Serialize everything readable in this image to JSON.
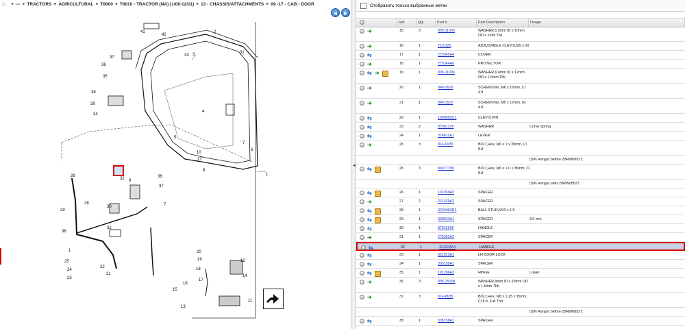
{
  "breadcrumb": [
    "---",
    "TRACTORS",
    "AGRICULTURAL",
    "T8000",
    "T8010 - TRACTOR (NA) (1/06-12/11)",
    "13 - CHASSIS/ATTACHMENTS",
    "09 -17 - CAB - DOOR"
  ],
  "nav": {
    "back": "◄",
    "forward": "►"
  },
  "filter_label": "Отобразить только выбранные метки",
  "columns": {
    "ref": "Ref",
    "qty": "Qty",
    "part": "Part #",
    "desc": "Part Description",
    "usage": "Usage"
  },
  "rows": [
    {
      "ref": "15",
      "qty": "3",
      "part": "895-11005",
      "desc": "WASHER,5.5mm ID x 10mm OD x 1mm Thk",
      "usage": "",
      "icons": [
        "gray",
        "arrow"
      ]
    },
    {
      "ref": "16",
      "qty": "1",
      "part": "713-125",
      "desc": "ADJUSTABLE CLEVIS,M5 x 20",
      "usage": "",
      "icons": [
        "gray",
        "arrow"
      ]
    },
    {
      "ref": "17",
      "qty": "1",
      "part": "275345A4",
      "desc": "COVER",
      "usage": "",
      "icons": [
        "gray",
        "swap"
      ]
    },
    {
      "ref": "18",
      "qty": "1",
      "part": "275344A6",
      "desc": "PROTECTOR",
      "usage": "",
      "icons": [
        "gray",
        "arrow"
      ]
    },
    {
      "ref": "19",
      "qty": "1",
      "part": "895-11006",
      "desc": "WASHER,6.6mm ID x 12mm OD x 1.6mm Thk",
      "usage": "",
      "icons": [
        "gray",
        "swap",
        "arrow2",
        "box2"
      ]
    },
    {
      "ref": "20",
      "qty": "1",
      "part": "840-1616",
      "desc": "SCREW,Pan, M6 x 16mm, Cl 4.8",
      "usage": "",
      "icons": [
        "gray",
        "arrow"
      ]
    },
    {
      "ref": "21",
      "qty": "1",
      "part": "840-1512",
      "desc": "SCREW,Pan, M5 x 12mm, Gr 4.8",
      "usage": "",
      "icons": [
        "gray",
        "arrow"
      ]
    },
    {
      "ref": "22",
      "qty": "1",
      "part": "1999650C1",
      "desc": "CLEVIS PIN",
      "usage": "",
      "icons": [
        "gray",
        "swap"
      ]
    },
    {
      "ref": "23",
      "qty": "2",
      "part": "87681226",
      "desc": "WASHER",
      "usage": "Curve Spring",
      "icons": [
        "gray",
        "swap"
      ]
    },
    {
      "ref": "24",
      "qty": "1",
      "part": "314611A1",
      "desc": "LEVER",
      "usage": "",
      "icons": [
        "gray",
        "swap"
      ]
    },
    {
      "ref": "25",
      "qty": "3",
      "part": "814-6035",
      "desc": "BOLT,Hex, M6 x 1 x 35mm, Cl 8.8",
      "usage": "",
      "icons": [
        "gray",
        "arrow"
      ]
    },
    {
      "note": "(S/N Range) before Z8RW08527;"
    },
    {
      "ref": "25",
      "qty": "3",
      "part": "86977789",
      "desc": "BOLT,Hex, M6 x 1.0 x 35mm, Cl 8.8",
      "usage": "",
      "icons": [
        "gray",
        "swap",
        "box"
      ]
    },
    {
      "note": "(S/N Range) after Z8RW08527;"
    },
    {
      "ref": "26",
      "qty": "1",
      "part": "191939A3",
      "desc": "SPACER",
      "usage": "",
      "icons": [
        "gray",
        "swap",
        "box"
      ]
    },
    {
      "ref": "27",
      "qty": "2",
      "part": "221429A2",
      "desc": "SPACER",
      "usage": "",
      "icons": [
        "gray",
        "arrow"
      ]
    },
    {
      "ref": "28",
      "qty": "1",
      "part": "3234063R1",
      "desc": "BALL STUD,M10 x 1.5",
      "usage": "",
      "icons": [
        "gray",
        "swap",
        "box"
      ]
    },
    {
      "ref": "29",
      "qty": "1",
      "part": "308633A1",
      "desc": "SPACER",
      "usage": "3.0 mm",
      "icons": [
        "gray",
        "swap",
        "box"
      ]
    },
    {
      "ref": "30",
      "qty": "1",
      "part": "87542696",
      "desc": "HANDLE",
      "usage": "",
      "icons": [
        "gray",
        "swap"
      ]
    },
    {
      "ref": "31",
      "qty": "1",
      "part": "275352A2",
      "desc": "SPACER",
      "usage": "",
      "icons": [
        "gray",
        "arrow"
      ]
    },
    {
      "ref": "32",
      "qty": "1",
      "part": "321023A4",
      "desc": "HANDLE",
      "usage": "",
      "icons": [
        "gray",
        "swap"
      ],
      "selected": true
    },
    {
      "ref": "33",
      "qty": "1",
      "part": "321013A1",
      "desc": "LH DOOR LOCK",
      "usage": "",
      "icons": [
        "gray",
        "swap"
      ]
    },
    {
      "ref": "34",
      "qty": "1",
      "part": "305159A1",
      "desc": "SPACER",
      "usage": "",
      "icons": [
        "gray",
        "swap"
      ]
    },
    {
      "ref": "35",
      "qty": "1",
      "part": "191286A3",
      "desc": "HINGE",
      "usage": "Lower",
      "icons": [
        "gray",
        "swap",
        "box"
      ]
    },
    {
      "ref": "36",
      "qty": "3",
      "part": "895-15008",
      "desc": "WASHER,9mm ID x 20mm OD x 1.6mm Thk",
      "usage": "",
      "icons": [
        "gray",
        "arrow"
      ]
    },
    {
      "ref": "37",
      "qty": "3",
      "part": "814-8635",
      "desc": "BOLT,Hex, M8 x 1.25 x 35mm, Cl 8.8, Full Thd",
      "usage": "",
      "icons": [
        "gray",
        "arrow"
      ]
    },
    {
      "note": "(S/N Range) before Z8RW08527;"
    },
    {
      "ref": "38",
      "qty": "1",
      "part": "305158A1",
      "desc": "SPACER",
      "usage": "",
      "icons": [
        "gray",
        "swap"
      ]
    }
  ],
  "callouts": [
    "41",
    "42",
    "2",
    "37",
    "36",
    "35",
    "38",
    "39",
    "34",
    "33",
    "31",
    "1",
    "3",
    "4",
    "5",
    "7",
    "6",
    "8",
    "9",
    "10",
    "27",
    "26",
    "29",
    "28",
    "30",
    "32",
    "36",
    "37",
    "38",
    "31",
    "7",
    "1",
    "25",
    "24",
    "23",
    "22",
    "21",
    "20",
    "19",
    "18",
    "17",
    "16",
    "15",
    "13",
    "12",
    "14",
    "11"
  ]
}
